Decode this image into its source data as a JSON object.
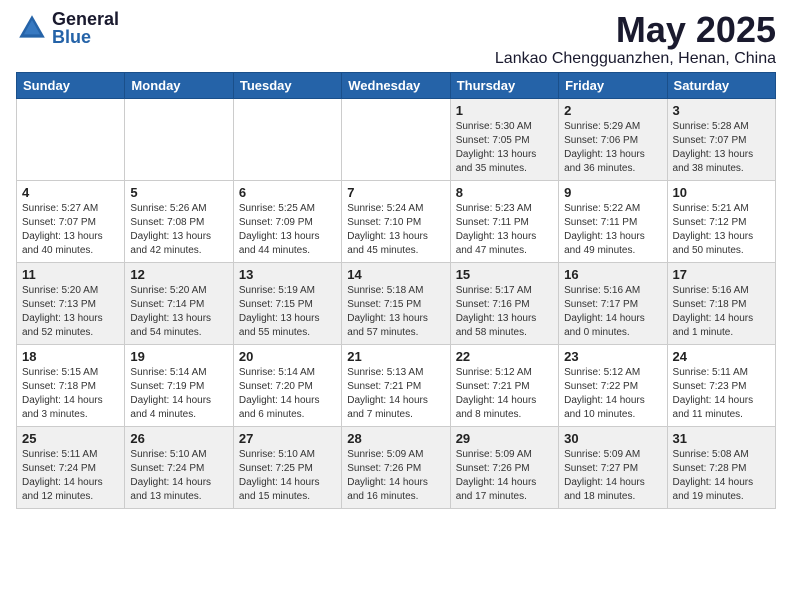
{
  "header": {
    "logo_general": "General",
    "logo_blue": "Blue",
    "month_title": "May 2025",
    "location": "Lankao Chengguanzhen, Henan, China"
  },
  "weekdays": [
    "Sunday",
    "Monday",
    "Tuesday",
    "Wednesday",
    "Thursday",
    "Friday",
    "Saturday"
  ],
  "weeks": [
    [
      {
        "day": "",
        "info": ""
      },
      {
        "day": "",
        "info": ""
      },
      {
        "day": "",
        "info": ""
      },
      {
        "day": "",
        "info": ""
      },
      {
        "day": "1",
        "info": "Sunrise: 5:30 AM\nSunset: 7:05 PM\nDaylight: 13 hours\nand 35 minutes."
      },
      {
        "day": "2",
        "info": "Sunrise: 5:29 AM\nSunset: 7:06 PM\nDaylight: 13 hours\nand 36 minutes."
      },
      {
        "day": "3",
        "info": "Sunrise: 5:28 AM\nSunset: 7:07 PM\nDaylight: 13 hours\nand 38 minutes."
      }
    ],
    [
      {
        "day": "4",
        "info": "Sunrise: 5:27 AM\nSunset: 7:07 PM\nDaylight: 13 hours\nand 40 minutes."
      },
      {
        "day": "5",
        "info": "Sunrise: 5:26 AM\nSunset: 7:08 PM\nDaylight: 13 hours\nand 42 minutes."
      },
      {
        "day": "6",
        "info": "Sunrise: 5:25 AM\nSunset: 7:09 PM\nDaylight: 13 hours\nand 44 minutes."
      },
      {
        "day": "7",
        "info": "Sunrise: 5:24 AM\nSunset: 7:10 PM\nDaylight: 13 hours\nand 45 minutes."
      },
      {
        "day": "8",
        "info": "Sunrise: 5:23 AM\nSunset: 7:11 PM\nDaylight: 13 hours\nand 47 minutes."
      },
      {
        "day": "9",
        "info": "Sunrise: 5:22 AM\nSunset: 7:11 PM\nDaylight: 13 hours\nand 49 minutes."
      },
      {
        "day": "10",
        "info": "Sunrise: 5:21 AM\nSunset: 7:12 PM\nDaylight: 13 hours\nand 50 minutes."
      }
    ],
    [
      {
        "day": "11",
        "info": "Sunrise: 5:20 AM\nSunset: 7:13 PM\nDaylight: 13 hours\nand 52 minutes."
      },
      {
        "day": "12",
        "info": "Sunrise: 5:20 AM\nSunset: 7:14 PM\nDaylight: 13 hours\nand 54 minutes."
      },
      {
        "day": "13",
        "info": "Sunrise: 5:19 AM\nSunset: 7:15 PM\nDaylight: 13 hours\nand 55 minutes."
      },
      {
        "day": "14",
        "info": "Sunrise: 5:18 AM\nSunset: 7:15 PM\nDaylight: 13 hours\nand 57 minutes."
      },
      {
        "day": "15",
        "info": "Sunrise: 5:17 AM\nSunset: 7:16 PM\nDaylight: 13 hours\nand 58 minutes."
      },
      {
        "day": "16",
        "info": "Sunrise: 5:16 AM\nSunset: 7:17 PM\nDaylight: 14 hours\nand 0 minutes."
      },
      {
        "day": "17",
        "info": "Sunrise: 5:16 AM\nSunset: 7:18 PM\nDaylight: 14 hours\nand 1 minute."
      }
    ],
    [
      {
        "day": "18",
        "info": "Sunrise: 5:15 AM\nSunset: 7:18 PM\nDaylight: 14 hours\nand 3 minutes."
      },
      {
        "day": "19",
        "info": "Sunrise: 5:14 AM\nSunset: 7:19 PM\nDaylight: 14 hours\nand 4 minutes."
      },
      {
        "day": "20",
        "info": "Sunrise: 5:14 AM\nSunset: 7:20 PM\nDaylight: 14 hours\nand 6 minutes."
      },
      {
        "day": "21",
        "info": "Sunrise: 5:13 AM\nSunset: 7:21 PM\nDaylight: 14 hours\nand 7 minutes."
      },
      {
        "day": "22",
        "info": "Sunrise: 5:12 AM\nSunset: 7:21 PM\nDaylight: 14 hours\nand 8 minutes."
      },
      {
        "day": "23",
        "info": "Sunrise: 5:12 AM\nSunset: 7:22 PM\nDaylight: 14 hours\nand 10 minutes."
      },
      {
        "day": "24",
        "info": "Sunrise: 5:11 AM\nSunset: 7:23 PM\nDaylight: 14 hours\nand 11 minutes."
      }
    ],
    [
      {
        "day": "25",
        "info": "Sunrise: 5:11 AM\nSunset: 7:24 PM\nDaylight: 14 hours\nand 12 minutes."
      },
      {
        "day": "26",
        "info": "Sunrise: 5:10 AM\nSunset: 7:24 PM\nDaylight: 14 hours\nand 13 minutes."
      },
      {
        "day": "27",
        "info": "Sunrise: 5:10 AM\nSunset: 7:25 PM\nDaylight: 14 hours\nand 15 minutes."
      },
      {
        "day": "28",
        "info": "Sunrise: 5:09 AM\nSunset: 7:26 PM\nDaylight: 14 hours\nand 16 minutes."
      },
      {
        "day": "29",
        "info": "Sunrise: 5:09 AM\nSunset: 7:26 PM\nDaylight: 14 hours\nand 17 minutes."
      },
      {
        "day": "30",
        "info": "Sunrise: 5:09 AM\nSunset: 7:27 PM\nDaylight: 14 hours\nand 18 minutes."
      },
      {
        "day": "31",
        "info": "Sunrise: 5:08 AM\nSunset: 7:28 PM\nDaylight: 14 hours\nand 19 minutes."
      }
    ]
  ]
}
